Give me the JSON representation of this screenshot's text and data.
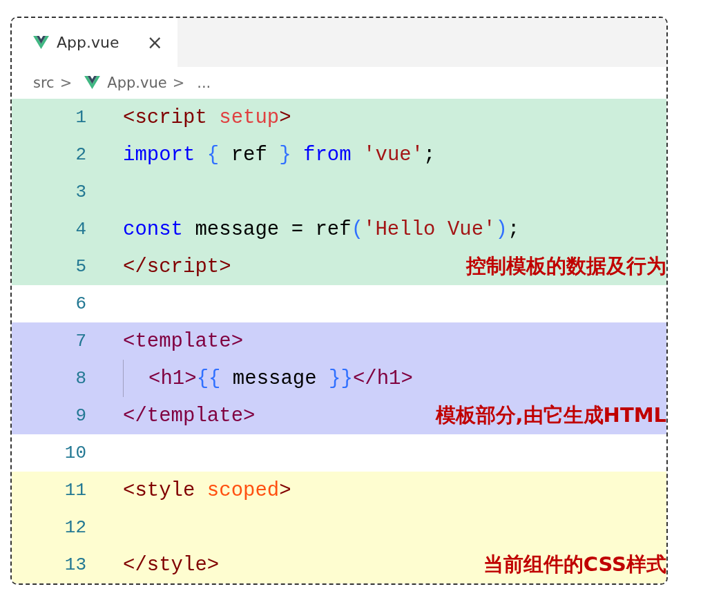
{
  "tabs": [
    {
      "label": "App.vue",
      "close": "×",
      "selected": true
    }
  ],
  "breadcrumb": {
    "items": [
      "src",
      "App.vue",
      "..."
    ],
    "separator": ">"
  },
  "regions": [
    {
      "color": "#cdeedb",
      "annotation": "控制模板的数据及行为",
      "lines": [
        {
          "number": "1",
          "tokens": [
            {
              "kind": "tag",
              "text": "<script "
            },
            {
              "kind": "attr",
              "text": "setup"
            },
            {
              "kind": "tag",
              "text": ">"
            }
          ]
        },
        {
          "number": "2",
          "tokens": [
            {
              "kind": "keyword",
              "text": "import "
            },
            {
              "kind": "brace",
              "text": "{"
            },
            {
              "kind": "plain",
              "text": " ref "
            },
            {
              "kind": "brace",
              "text": "} "
            },
            {
              "kind": "keyword",
              "text": "from "
            },
            {
              "kind": "string",
              "text": "'vue'"
            },
            {
              "kind": "plain",
              "text": ";"
            }
          ]
        },
        {
          "number": "3"
        },
        {
          "number": "4",
          "tokens": [
            {
              "kind": "keyword",
              "text": "const"
            },
            {
              "kind": "plain",
              "text": " message = ref"
            },
            {
              "kind": "brace",
              "text": "("
            },
            {
              "kind": "string",
              "text": "'Hello Vue'"
            },
            {
              "kind": "brace",
              "text": ")"
            },
            {
              "kind": "plain",
              "text": ";"
            }
          ]
        },
        {
          "number": "5",
          "tokens": [
            {
              "kind": "tag",
              "text": "</script>"
            }
          ]
        }
      ]
    },
    {
      "color": "#ffffff",
      "lines": [
        {
          "number": "6"
        }
      ]
    },
    {
      "color": "#cdd0fa",
      "annotation": "模板部分,由它生成HTML",
      "lines": [
        {
          "number": "7",
          "tokens": [
            {
              "kind": "tag2",
              "text": "<template>"
            }
          ]
        },
        {
          "number": "8",
          "guide": true,
          "tokens": [
            {
              "kind": "tag2",
              "text": "<h1>"
            },
            {
              "kind": "brace",
              "text": "{{"
            },
            {
              "kind": "plain",
              "text": " message "
            },
            {
              "kind": "brace",
              "text": "}}"
            },
            {
              "kind": "tag2",
              "text": "</h1>"
            }
          ]
        },
        {
          "number": "9",
          "tokens": [
            {
              "kind": "tag2",
              "text": "</template>"
            }
          ]
        }
      ]
    },
    {
      "color": "#ffffff",
      "lines": [
        {
          "number": "10"
        }
      ]
    },
    {
      "color": "#fefdd0",
      "annotation": "当前组件的CSS样式",
      "lines": [
        {
          "number": "11",
          "tokens": [
            {
              "kind": "tag",
              "text": "<style "
            },
            {
              "kind": "attr2",
              "text": "scoped"
            },
            {
              "kind": "tag",
              "text": ">"
            }
          ]
        },
        {
          "number": "12"
        },
        {
          "number": "13",
          "tokens": [
            {
              "kind": "tag",
              "text": "</style>"
            }
          ]
        }
      ]
    }
  ]
}
